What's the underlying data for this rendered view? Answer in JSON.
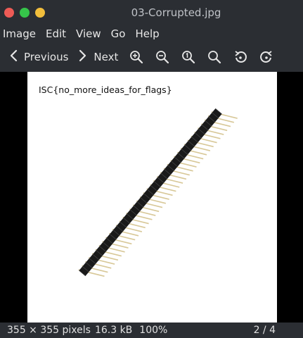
{
  "window": {
    "title": "03-Corrupted.jpg",
    "traffic_colors": {
      "close": "#ee5b56",
      "minimize": "#f2be3c",
      "maximize": "#36c44a"
    }
  },
  "menu": [
    "Image",
    "Edit",
    "View",
    "Go",
    "Help"
  ],
  "toolbar": {
    "previous_label": "Previous",
    "next_label": "Next",
    "icons": [
      "chevron-left-icon",
      "chevron-right-icon",
      "zoom-in-icon",
      "zoom-out-icon",
      "zoom-1to1-icon",
      "zoom-fit-icon",
      "rotate-left-icon",
      "rotate-right-icon"
    ]
  },
  "image": {
    "overlay_text": "ISC{no_more_ideas_for_flags}",
    "subject": "pin header strip"
  },
  "status": {
    "dimensions": "355 × 355 pixels",
    "filesize": "16.3 kB",
    "zoom": "100%",
    "position": "2 / 4"
  }
}
